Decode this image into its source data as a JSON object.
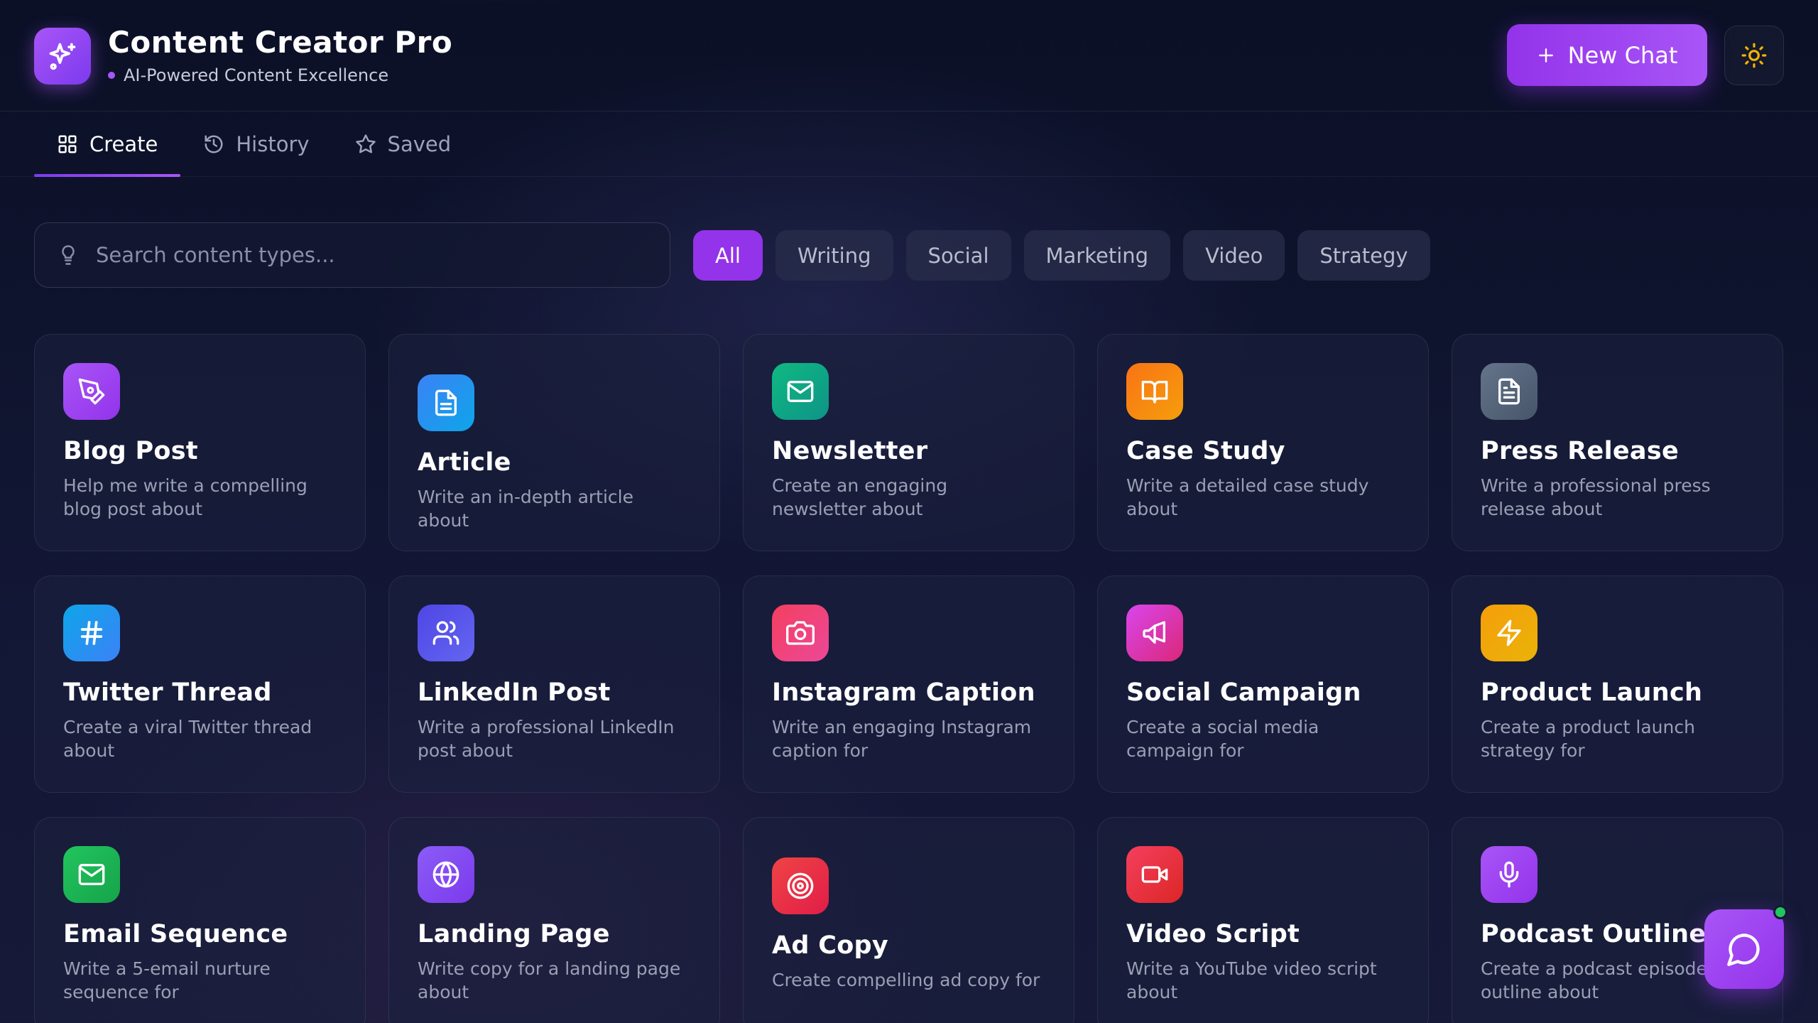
{
  "app": {
    "title": "Content Creator Pro",
    "subtitle": "AI-Powered Content Excellence",
    "logo_icon": "sparkles-icon",
    "accent": "#a855f7"
  },
  "header": {
    "new_chat_label": "New Chat",
    "theme_icon": "sun-icon"
  },
  "tabs": [
    {
      "label": "Create",
      "icon": "grid-icon",
      "active": true
    },
    {
      "label": "History",
      "icon": "history-icon",
      "active": false
    },
    {
      "label": "Saved",
      "icon": "star-icon",
      "active": false
    }
  ],
  "search": {
    "placeholder": "Search content types...",
    "icon": "lightbulb-icon"
  },
  "filters": [
    {
      "label": "All",
      "active": true
    },
    {
      "label": "Writing",
      "active": false
    },
    {
      "label": "Social",
      "active": false
    },
    {
      "label": "Marketing",
      "active": false
    },
    {
      "label": "Video",
      "active": false
    },
    {
      "label": "Strategy",
      "active": false
    }
  ],
  "cards": [
    {
      "title": "Blog Post",
      "desc": "Help me write a compelling blog post about",
      "icon": "pen-tool-icon",
      "color": "#a855f7"
    },
    {
      "title": "Article",
      "desc": "Write an in-depth article about",
      "icon": "file-text-icon",
      "color": "#3b82f6"
    },
    {
      "title": "Newsletter",
      "desc": "Create an engaging newsletter about",
      "icon": "mail-icon",
      "color": "#10b981"
    },
    {
      "title": "Case Study",
      "desc": "Write a detailed case study about",
      "icon": "book-open-icon",
      "color": "#f97316"
    },
    {
      "title": "Press Release",
      "desc": "Write a professional press release about",
      "icon": "document-icon",
      "color": "#64748b"
    },
    {
      "title": "Twitter Thread",
      "desc": "Create a viral Twitter thread about",
      "icon": "hash-icon",
      "color": "#0ea5e9"
    },
    {
      "title": "LinkedIn Post",
      "desc": "Write a professional LinkedIn post about",
      "icon": "users-icon",
      "color": "#4f46e5"
    },
    {
      "title": "Instagram Caption",
      "desc": "Write an engaging Instagram caption for",
      "icon": "camera-icon",
      "color": "#f43f5e"
    },
    {
      "title": "Social Campaign",
      "desc": "Create a social media campaign for",
      "icon": "megaphone-icon",
      "color": "#d946ef"
    },
    {
      "title": "Product Launch",
      "desc": "Create a product launch strategy for",
      "icon": "zap-icon",
      "color": "#f59e0b"
    },
    {
      "title": "Email Sequence",
      "desc": "Write a 5-email nurture sequence for",
      "icon": "mail-icon",
      "color": "#22c55e"
    },
    {
      "title": "Landing Page",
      "desc": "Write copy for a landing page about",
      "icon": "globe-icon",
      "color": "#8b5cf6"
    },
    {
      "title": "Ad Copy",
      "desc": "Create compelling ad copy for",
      "icon": "target-icon",
      "color": "#ef4444"
    },
    {
      "title": "Video Script",
      "desc": "Write a YouTube video script about",
      "icon": "video-icon",
      "color": "#f43f5e"
    },
    {
      "title": "Podcast Outline",
      "desc": "Create a podcast episode outline about",
      "icon": "mic-icon",
      "color": "#a855f7"
    }
  ],
  "fab": {
    "icon": "chat-bubble-icon",
    "status_color": "#22c55e"
  }
}
